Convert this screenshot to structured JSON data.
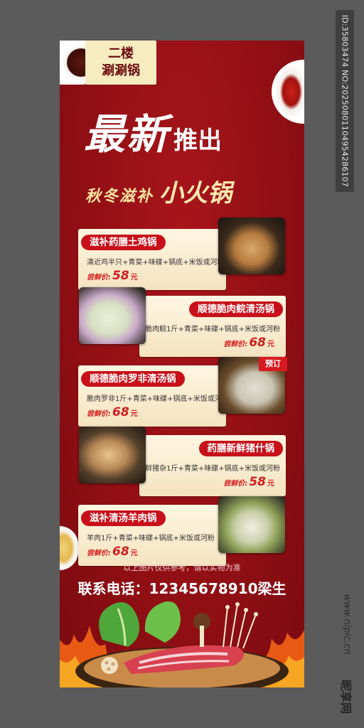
{
  "watermark": {
    "id_text": "ID:35803474 NO:20250801104954286107",
    "url": "www.nipic.cn",
    "logo": "昵享网"
  },
  "tag": {
    "line1": "二楼",
    "line2": "涮涮锅"
  },
  "headline": {
    "part1": "最新",
    "part2": "推出"
  },
  "subline": {
    "part1": "秋冬滋补",
    "part2": "小火锅"
  },
  "items": [
    {
      "name": "滋补药膳土鸡锅",
      "desc": "清近鸡半只+青菜+味碟+锅底+米饭或河粉",
      "price_label": "尝鲜价:",
      "price": "58",
      "unit": "元"
    },
    {
      "name": "顺德脆肉鲩清汤锅",
      "desc": "脆肉鲩1斤+青菜+味碟+锅底+米饭或河粉",
      "price_label": "尝鲜价:",
      "price": "68",
      "unit": "元"
    },
    {
      "name": "顺德脆肉罗非清汤锅",
      "desc": "脆肉罗非1斤+青菜+味碟+锅底+米饭或河粉",
      "price_label": "尝鲜价:",
      "price": "68",
      "unit": "元"
    },
    {
      "name": "药膳新鲜猪什锅",
      "desc": "新鲜猪杂1斤+青菜+味碟+锅底+米饭或河粉",
      "price_label": "尝鲜价:",
      "price": "58",
      "unit": "元"
    },
    {
      "name": "滋补清汤羊肉锅",
      "desc": "羊肉1斤+青菜+味碟+锅底+米饭或河粉",
      "price_label": "尝鲜价:",
      "price": "68",
      "unit": "元"
    }
  ],
  "badge": "预订",
  "disclaimer": "以上图片仅供参考，请以实物为准",
  "contact": "联系电话：12345678910梁生",
  "colors": {
    "poster_red": "#8f0f14",
    "pill_red": "#c8101a",
    "price_red": "#d11e1e",
    "card_cream": "#fff6e2"
  }
}
